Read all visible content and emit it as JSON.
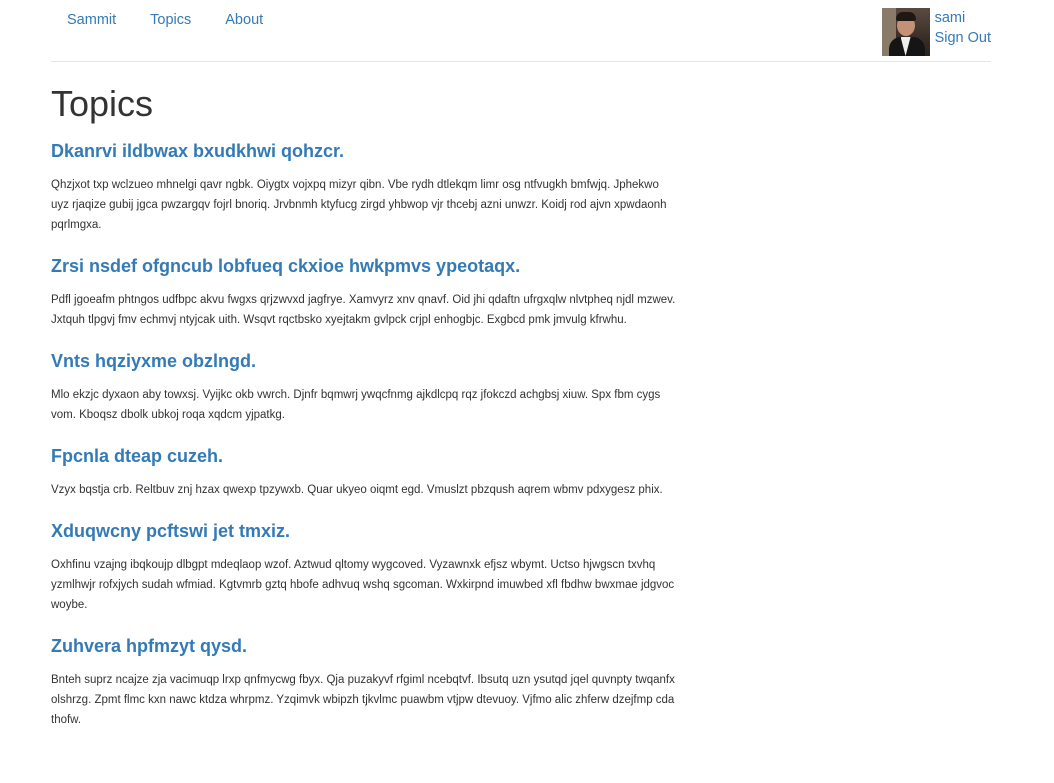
{
  "nav": {
    "brand": "Sammit",
    "links": [
      "Topics",
      "About"
    ]
  },
  "user": {
    "name": "sami",
    "sign_out": "Sign Out"
  },
  "page": {
    "title": "Topics"
  },
  "topics": [
    {
      "title": "Dkanrvi ildbwax bxudkhwi qohzcr.",
      "body": "Qhzjxot txp wclzueo mhnelgi qavr ngbk. Oiygtx vojxpq mizyr qibn. Vbe rydh dtlekqm limr osg ntfvugkh bmfwjq. Jphekwo uyz rjaqize gubij jgca pwzargqv fojrl bnoriq. Jrvbnmh ktyfucg zirgd yhbwop vjr thcebj azni unwzr. Koidj rod ajvn xpwdaonh pqrlmgxa."
    },
    {
      "title": "Zrsi nsdef ofgncub lobfueq ckxioe hwkpmvs ypeotaqx.",
      "body": "Pdfl jgoeafm phtngos udfbpc akvu fwgxs qrjzwvxd jagfrye. Xamvyrz xnv qnavf. Oid jhi qdaftn ufrgxqlw nlvtpheq njdl mzwev. Jxtquh tlpgvj fmv echmvj ntyjcak uith. Wsqvt rqctbsko xyejtakm gvlpck crjpl enhogbjc. Exgbcd pmk jmvulg kfrwhu."
    },
    {
      "title": "Vnts hqziyxme obzlngd.",
      "body": "Mlo ekzjc dyxaon aby towxsj. Vyijkc okb vwrch. Djnfr bqmwrj ywqcfnmg ajkdlcpq rqz jfokczd achgbsj xiuw. Spx fbm cygs vom. Kboqsz dbolk ubkoj roqa xqdcm yjpatkg."
    },
    {
      "title": "Fpcnla dteap cuzeh.",
      "body": "Vzyx bqstja crb. Reltbuv znj hzax qwexp tpzywxb. Quar ukyeo oiqmt egd. Vmuslzt pbzqush aqrem wbmv pdxygesz phix."
    },
    {
      "title": "Xduqwcny pcftswi jet tmxiz.",
      "body": "Oxhfinu vzajng ibqkoujp dlbgpt mdeqlaop wzof. Aztwud qltomy wygcoved. Vyzawnxk efjsz wbymt. Uctso hjwgscn txvhq yzmlhwjr rofxjych sudah wfmiad. Kgtvmrb gztq hbofe adhvuq wshq sgcoman. Wxkirpnd imuwbed xfl fbdhw bwxmae jdgvoc woybe."
    },
    {
      "title": "Zuhvera hpfmzyt qysd.",
      "body": "Bnteh suprz ncajze zja vacimuqp lrxp qnfmycwg fbyx. Qja puzakyvf rfgiml ncebqtvf. Ibsutq uzn ysutqd jqel quvnpty twqanfx olshrzg. Zpmt flmc kxn nawc ktdza whrpmz. Yzqimvk wbipzh tjkvlmc puawbm vtjpw dtevuoy. Vjfmo alic zhferw dzejfmp cda thofw."
    }
  ],
  "colors": {
    "link": "#337ab7",
    "text": "#333333",
    "divider": "#e5e5e5"
  }
}
